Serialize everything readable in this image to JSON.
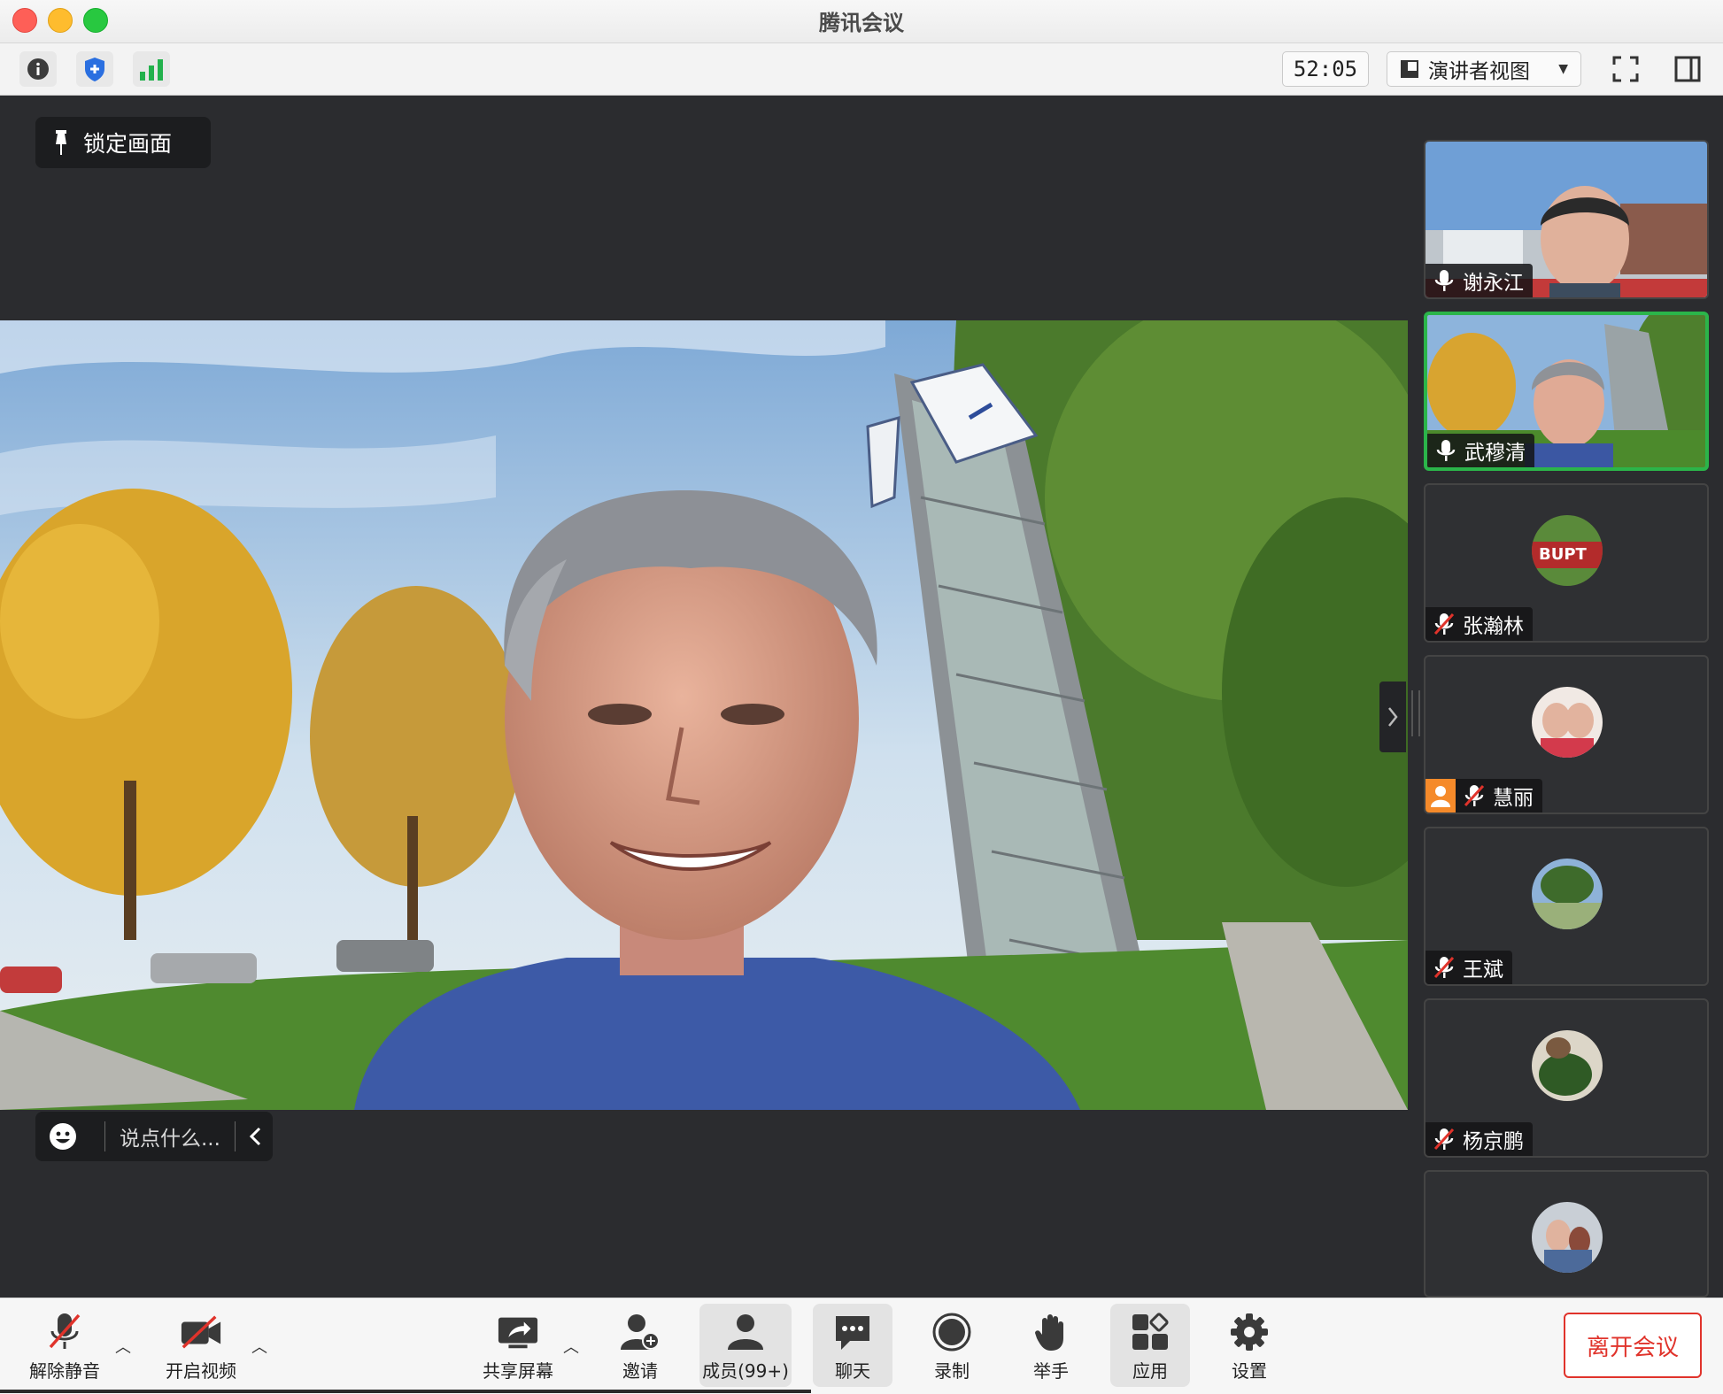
{
  "window": {
    "title": "腾讯会议"
  },
  "toolbar": {
    "timer": "52:05",
    "view_mode": "演讲者视图"
  },
  "main": {
    "lock_label": "锁定画面",
    "chat_placeholder": "说点什么..."
  },
  "participants": [
    {
      "name": "谢永江",
      "mic": "on",
      "video": "on"
    },
    {
      "name": "武穆清",
      "mic": "on",
      "video": "on",
      "active": true
    },
    {
      "name": "张瀚林",
      "mic": "muted",
      "video": "off"
    },
    {
      "name": "慧丽",
      "mic": "muted",
      "video": "off",
      "host_badge": true
    },
    {
      "name": "王斌",
      "mic": "muted",
      "video": "off"
    },
    {
      "name": "杨京鹏",
      "mic": "muted",
      "video": "off"
    },
    {
      "name": "",
      "mic": "muted",
      "video": "off"
    }
  ],
  "bottom": {
    "unmute": "解除静音",
    "video": "开启视频",
    "share": "共享屏幕",
    "invite": "邀请",
    "members": "成员(99+)",
    "chat": "聊天",
    "record": "录制",
    "raise_hand": "举手",
    "apps": "应用",
    "settings": "设置",
    "leave": "离开会议"
  },
  "colors": {
    "accent_green": "#2bb54a",
    "leave_red": "#e0332b",
    "panel_dark": "#2b2c2f"
  }
}
